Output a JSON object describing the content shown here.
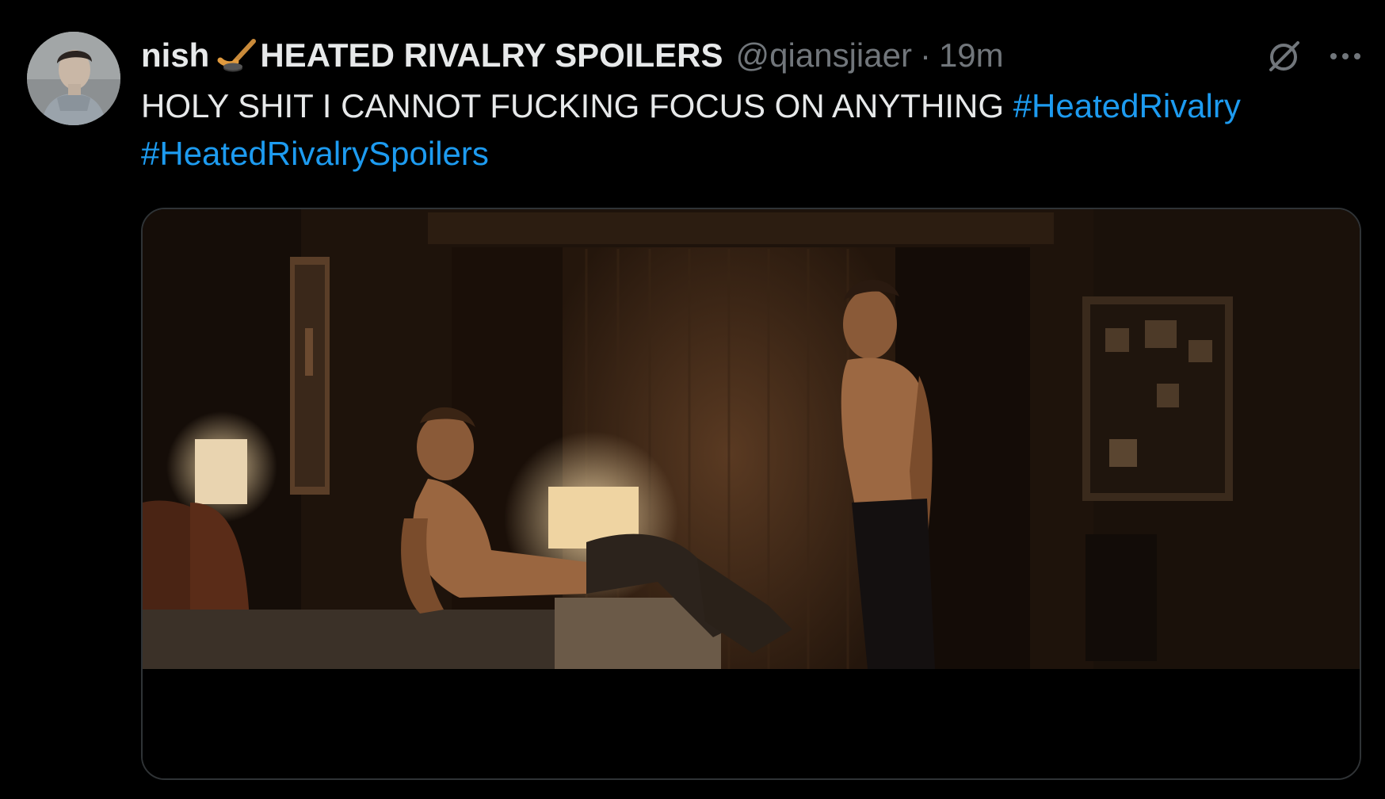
{
  "tweet": {
    "display_name": "nish",
    "name_emoji": "hockey-stick-and-puck",
    "account_suffix": "HEATED RIVALRY SPOILERS",
    "handle": "@qiansjiaer",
    "separator": "·",
    "timestamp": "19m",
    "text": "HOLY SHIT I CANNOT FUCKING FOCUS ON ANYTHING",
    "hashtags": [
      "#HeatedRivalry",
      "#HeatedRivalrySpoilers"
    ],
    "media": {
      "kind": "video-still",
      "scene": "dim hotel room, two shirtless men, one reclining on bed, one standing by window"
    }
  },
  "icons": {
    "avatar": "profile-photo",
    "grok": "grok-icon",
    "more": "more-horizontal-icon"
  },
  "colors": {
    "background": "#000000",
    "text": "#e7e9ea",
    "muted": "#71767b",
    "link": "#1d9bf0",
    "border": "#2f3336"
  }
}
